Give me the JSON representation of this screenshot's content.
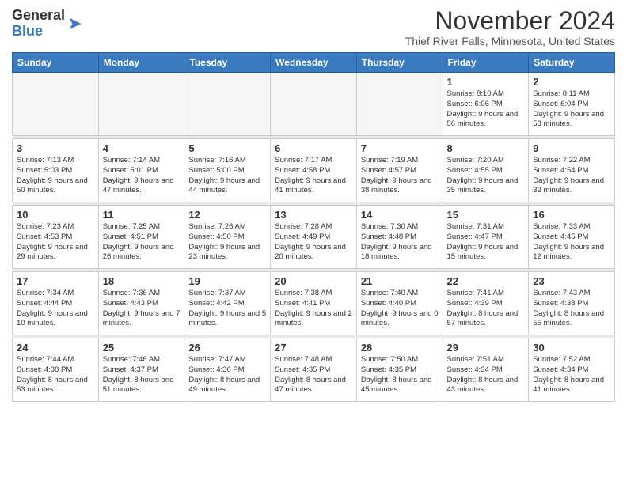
{
  "header": {
    "logo_general": "General",
    "logo_blue": "Blue",
    "title": "November 2024",
    "location": "Thief River Falls, Minnesota, United States"
  },
  "days_of_week": [
    "Sunday",
    "Monday",
    "Tuesday",
    "Wednesday",
    "Thursday",
    "Friday",
    "Saturday"
  ],
  "weeks": [
    [
      {
        "day": "",
        "info": ""
      },
      {
        "day": "",
        "info": ""
      },
      {
        "day": "",
        "info": ""
      },
      {
        "day": "",
        "info": ""
      },
      {
        "day": "",
        "info": ""
      },
      {
        "day": "1",
        "info": "Sunrise: 8:10 AM\nSunset: 6:06 PM\nDaylight: 9 hours and 56 minutes."
      },
      {
        "day": "2",
        "info": "Sunrise: 8:11 AM\nSunset: 6:04 PM\nDaylight: 9 hours and 53 minutes."
      }
    ],
    [
      {
        "day": "3",
        "info": "Sunrise: 7:13 AM\nSunset: 5:03 PM\nDaylight: 9 hours and 50 minutes."
      },
      {
        "day": "4",
        "info": "Sunrise: 7:14 AM\nSunset: 5:01 PM\nDaylight: 9 hours and 47 minutes."
      },
      {
        "day": "5",
        "info": "Sunrise: 7:16 AM\nSunset: 5:00 PM\nDaylight: 9 hours and 44 minutes."
      },
      {
        "day": "6",
        "info": "Sunrise: 7:17 AM\nSunset: 4:58 PM\nDaylight: 9 hours and 41 minutes."
      },
      {
        "day": "7",
        "info": "Sunrise: 7:19 AM\nSunset: 4:57 PM\nDaylight: 9 hours and 38 minutes."
      },
      {
        "day": "8",
        "info": "Sunrise: 7:20 AM\nSunset: 4:55 PM\nDaylight: 9 hours and 35 minutes."
      },
      {
        "day": "9",
        "info": "Sunrise: 7:22 AM\nSunset: 4:54 PM\nDaylight: 9 hours and 32 minutes."
      }
    ],
    [
      {
        "day": "10",
        "info": "Sunrise: 7:23 AM\nSunset: 4:53 PM\nDaylight: 9 hours and 29 minutes."
      },
      {
        "day": "11",
        "info": "Sunrise: 7:25 AM\nSunset: 4:51 PM\nDaylight: 9 hours and 26 minutes."
      },
      {
        "day": "12",
        "info": "Sunrise: 7:26 AM\nSunset: 4:50 PM\nDaylight: 9 hours and 23 minutes."
      },
      {
        "day": "13",
        "info": "Sunrise: 7:28 AM\nSunset: 4:49 PM\nDaylight: 9 hours and 20 minutes."
      },
      {
        "day": "14",
        "info": "Sunrise: 7:30 AM\nSunset: 4:48 PM\nDaylight: 9 hours and 18 minutes."
      },
      {
        "day": "15",
        "info": "Sunrise: 7:31 AM\nSunset: 4:47 PM\nDaylight: 9 hours and 15 minutes."
      },
      {
        "day": "16",
        "info": "Sunrise: 7:33 AM\nSunset: 4:45 PM\nDaylight: 9 hours and 12 minutes."
      }
    ],
    [
      {
        "day": "17",
        "info": "Sunrise: 7:34 AM\nSunset: 4:44 PM\nDaylight: 9 hours and 10 minutes."
      },
      {
        "day": "18",
        "info": "Sunrise: 7:36 AM\nSunset: 4:43 PM\nDaylight: 9 hours and 7 minutes."
      },
      {
        "day": "19",
        "info": "Sunrise: 7:37 AM\nSunset: 4:42 PM\nDaylight: 9 hours and 5 minutes."
      },
      {
        "day": "20",
        "info": "Sunrise: 7:38 AM\nSunset: 4:41 PM\nDaylight: 9 hours and 2 minutes."
      },
      {
        "day": "21",
        "info": "Sunrise: 7:40 AM\nSunset: 4:40 PM\nDaylight: 9 hours and 0 minutes."
      },
      {
        "day": "22",
        "info": "Sunrise: 7:41 AM\nSunset: 4:39 PM\nDaylight: 8 hours and 57 minutes."
      },
      {
        "day": "23",
        "info": "Sunrise: 7:43 AM\nSunset: 4:38 PM\nDaylight: 8 hours and 55 minutes."
      }
    ],
    [
      {
        "day": "24",
        "info": "Sunrise: 7:44 AM\nSunset: 4:38 PM\nDaylight: 8 hours and 53 minutes."
      },
      {
        "day": "25",
        "info": "Sunrise: 7:46 AM\nSunset: 4:37 PM\nDaylight: 8 hours and 51 minutes."
      },
      {
        "day": "26",
        "info": "Sunrise: 7:47 AM\nSunset: 4:36 PM\nDaylight: 8 hours and 49 minutes."
      },
      {
        "day": "27",
        "info": "Sunrise: 7:48 AM\nSunset: 4:35 PM\nDaylight: 8 hours and 47 minutes."
      },
      {
        "day": "28",
        "info": "Sunrise: 7:50 AM\nSunset: 4:35 PM\nDaylight: 8 hours and 45 minutes."
      },
      {
        "day": "29",
        "info": "Sunrise: 7:51 AM\nSunset: 4:34 PM\nDaylight: 8 hours and 43 minutes."
      },
      {
        "day": "30",
        "info": "Sunrise: 7:52 AM\nSunset: 4:34 PM\nDaylight: 8 hours and 41 minutes."
      }
    ]
  ]
}
